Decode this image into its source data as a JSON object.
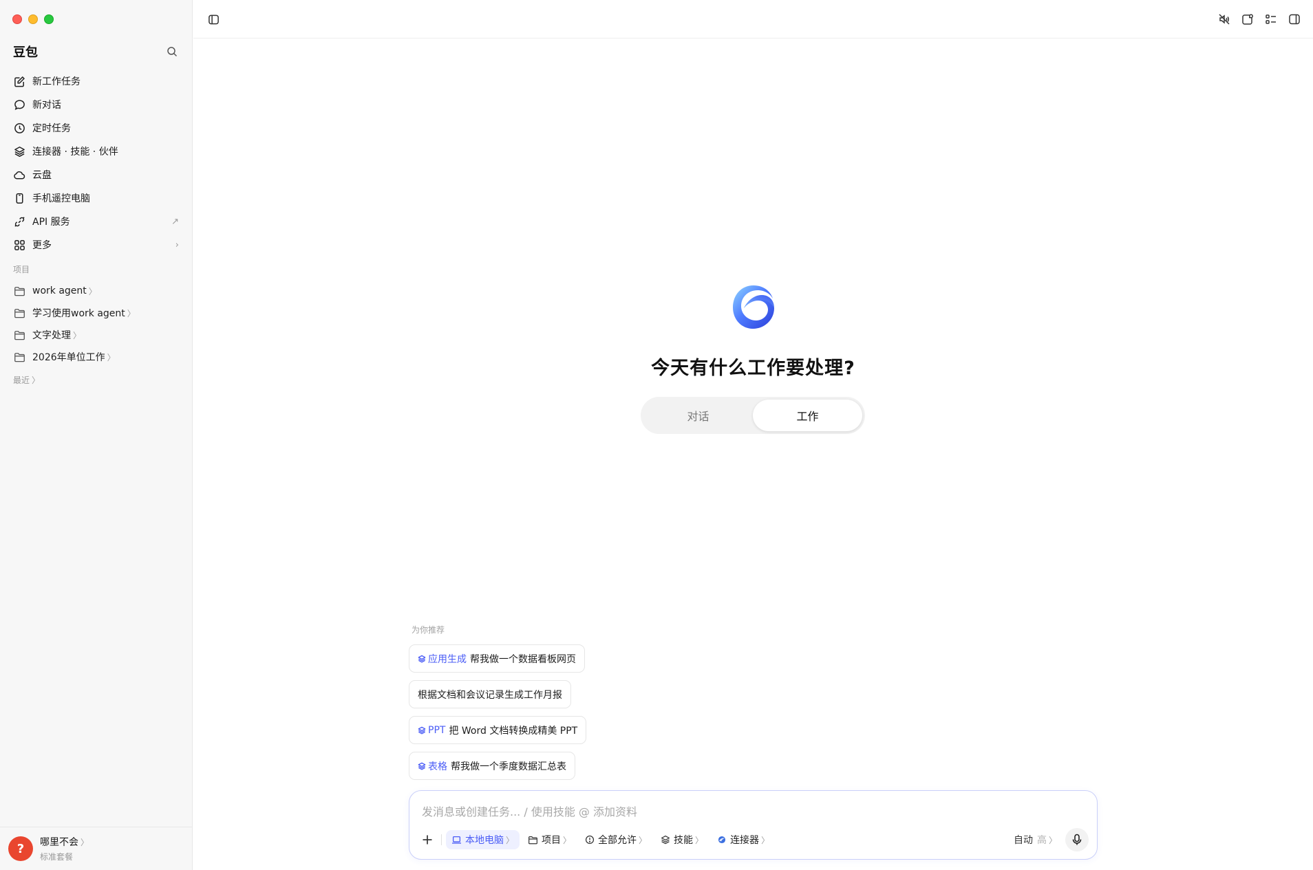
{
  "sidebar": {
    "brand": "豆包",
    "nav_items": [
      {
        "label": "新工作任务",
        "icon": "edit-icon"
      },
      {
        "label": "新对话",
        "icon": "chat-bubble-icon"
      },
      {
        "label": "定时任务",
        "icon": "clock-icon"
      },
      {
        "label": "连接器 · 技能 · 伙伴",
        "icon": "layers-icon"
      },
      {
        "label": "云盘",
        "icon": "cloud-icon"
      },
      {
        "label": "手机遥控电脑",
        "icon": "phone-icon"
      },
      {
        "label": "API 服务",
        "icon": "api-icon",
        "suffix": "↗"
      },
      {
        "label": "更多",
        "icon": "grid-icon",
        "suffix": "›"
      }
    ],
    "projects_label": "项目",
    "projects": [
      {
        "label": "work agent"
      },
      {
        "label": "学习使用work agent"
      },
      {
        "label": "文字处理"
      },
      {
        "label": "2026年单位工作"
      }
    ],
    "recent_label": "最近",
    "user": {
      "name": "哪里不会",
      "plan": "标准套餐",
      "avatar_glyph": "?"
    }
  },
  "main": {
    "title": "今天有什么工作要处理?",
    "modes": [
      {
        "label": "对话",
        "active": false
      },
      {
        "label": "工作",
        "active": true
      }
    ],
    "suggest_label": "为你推荐",
    "suggestions": [
      {
        "tag": "应用生成",
        "text": "帮我做一个数据看板网页"
      },
      {
        "tag": "",
        "text": "根据文档和会议记录生成工作月报"
      },
      {
        "tag": "PPT",
        "text": "把 Word 文档转换成精美 PPT"
      },
      {
        "tag": "表格",
        "text": "帮我做一个季度数据汇总表"
      }
    ],
    "composer": {
      "placeholder": "发消息或创建任务... / 使用技能 @ 添加资料",
      "pills": [
        {
          "label": "本地电脑",
          "icon": "laptop-icon",
          "active": true
        },
        {
          "label": "项目",
          "icon": "folder-icon",
          "active": false
        },
        {
          "label": "全部允许",
          "icon": "alert-circle-icon",
          "active": false
        },
        {
          "label": "技能",
          "icon": "layers-icon",
          "active": false
        },
        {
          "label": "连接器",
          "icon": "connector-icon",
          "active": false
        }
      ],
      "model_label": "自动",
      "model_sub": "高"
    }
  },
  "colors": {
    "accent": "#4a5cf6",
    "sidebar_bg": "#f7f7f7",
    "avatar": "#e9462f"
  }
}
